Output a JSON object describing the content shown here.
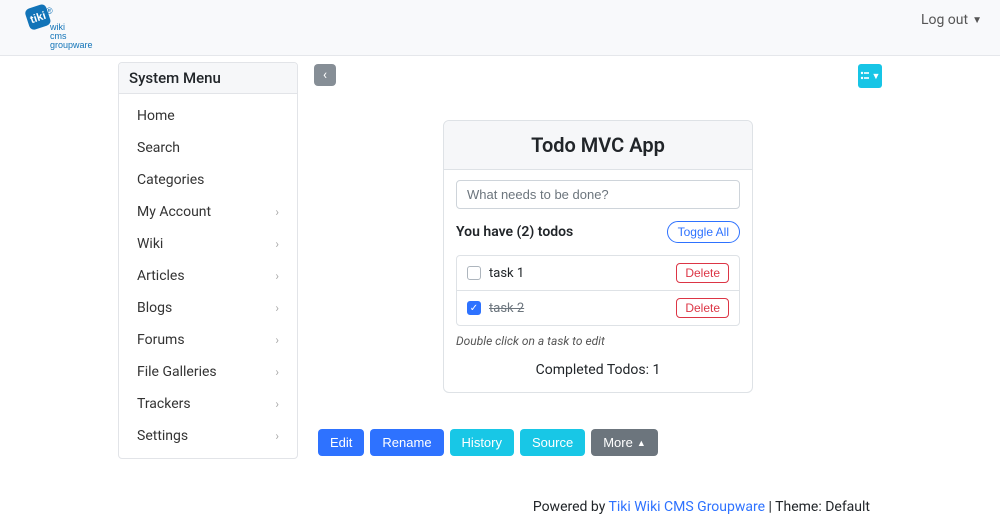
{
  "header": {
    "logout_label": "Log out"
  },
  "sidebar": {
    "title": "System Menu",
    "items": [
      {
        "label": "Home",
        "expandable": false
      },
      {
        "label": "Search",
        "expandable": false
      },
      {
        "label": "Categories",
        "expandable": false
      },
      {
        "label": "My Account",
        "expandable": true
      },
      {
        "label": "Wiki",
        "expandable": true
      },
      {
        "label": "Articles",
        "expandable": true
      },
      {
        "label": "Blogs",
        "expandable": true
      },
      {
        "label": "Forums",
        "expandable": true
      },
      {
        "label": "File Galleries",
        "expandable": true
      },
      {
        "label": "Trackers",
        "expandable": true
      },
      {
        "label": "Settings",
        "expandable": true
      }
    ]
  },
  "app": {
    "title": "Todo MVC App",
    "input_placeholder": "What needs to be done?",
    "status_text": "You have (2) todos",
    "toggle_all_label": "Toggle All",
    "todos": [
      {
        "label": "task 1",
        "done": false,
        "delete_label": "Delete"
      },
      {
        "label": "task 2",
        "done": true,
        "delete_label": "Delete"
      }
    ],
    "hint": "Double click on a task to edit",
    "completed_text": "Completed Todos: 1"
  },
  "actions": {
    "edit": "Edit",
    "rename": "Rename",
    "history": "History",
    "source": "Source",
    "more": "More"
  },
  "footer": {
    "prefix": "Powered by ",
    "link": "Tiki Wiki CMS Groupware",
    "theme_prefix": " | Theme: ",
    "theme": "Default"
  }
}
